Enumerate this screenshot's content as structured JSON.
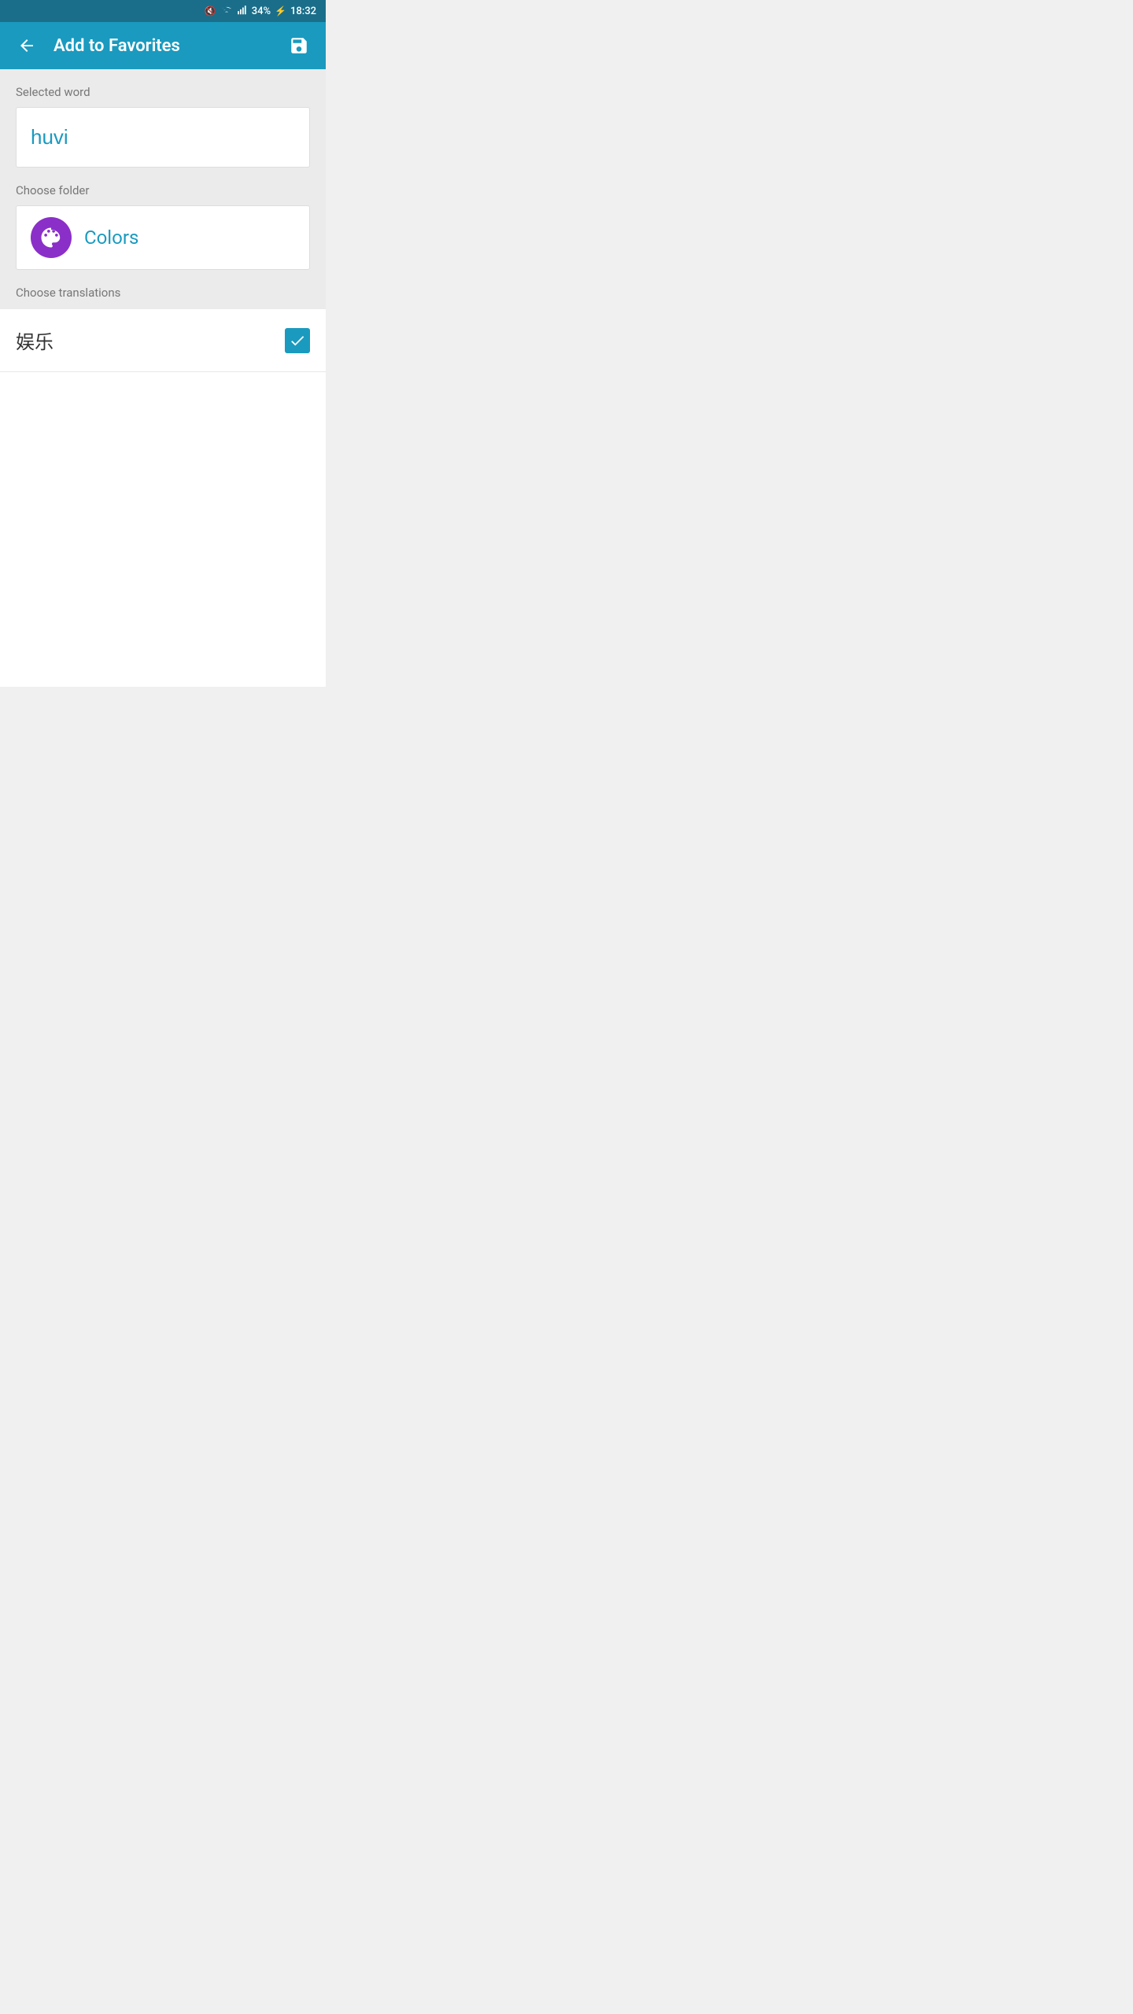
{
  "statusBar": {
    "battery": "34%",
    "time": "18:32"
  },
  "appBar": {
    "title": "Add to Favorites",
    "backLabel": "←",
    "saveLabel": "💾"
  },
  "selectedWord": {
    "label": "Selected word",
    "value": "huvi"
  },
  "chooseFolder": {
    "label": "Choose folder",
    "folderName": "Colors"
  },
  "chooseTranslations": {
    "label": "Choose translations",
    "items": [
      {
        "text": "娱乐",
        "checked": true
      }
    ]
  }
}
